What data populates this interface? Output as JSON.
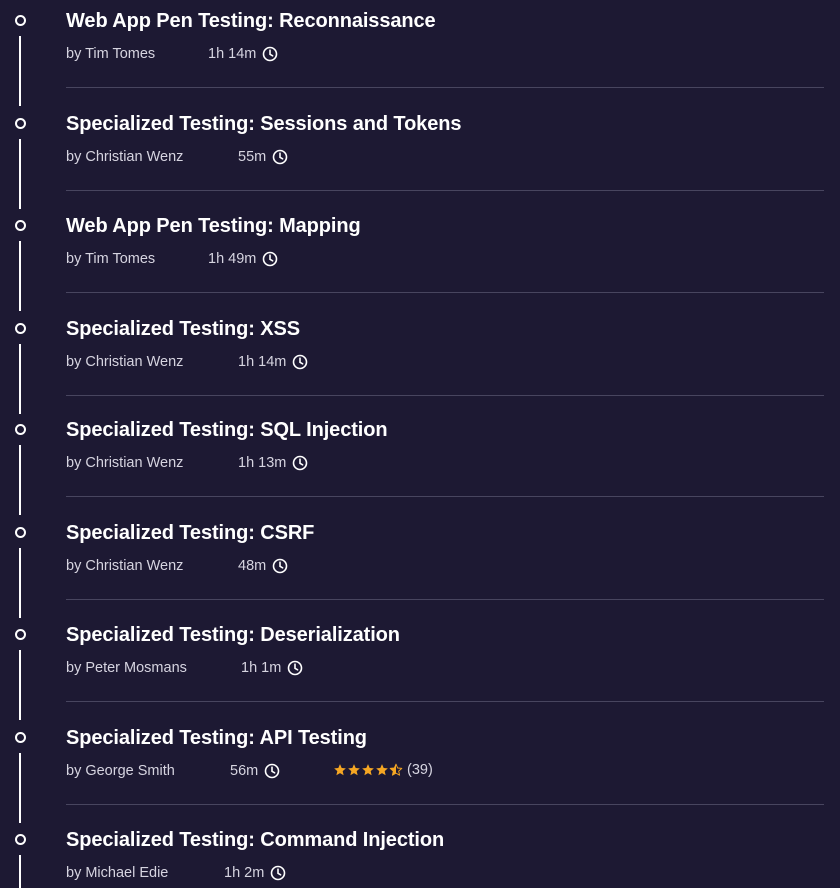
{
  "courses": [
    {
      "title": "Web App Pen Testing: Reconnaissance",
      "author": "by Tim Tomes",
      "duration": "1h 14m"
    },
    {
      "title": "Specialized Testing: Sessions and Tokens",
      "author": "by Christian Wenz",
      "duration": "55m"
    },
    {
      "title": "Web App Pen Testing: Mapping",
      "author": "by Tim Tomes",
      "duration": "1h 49m"
    },
    {
      "title": "Specialized Testing: XSS",
      "author": "by Christian Wenz",
      "duration": "1h 14m"
    },
    {
      "title": "Specialized Testing: SQL Injection",
      "author": "by Christian Wenz",
      "duration": "1h 13m"
    },
    {
      "title": "Specialized Testing: CSRF",
      "author": "by Christian Wenz",
      "duration": "48m"
    },
    {
      "title": "Specialized Testing: Deserialization",
      "author": "by Peter Mosmans",
      "duration": "1h 1m"
    },
    {
      "title": "Specialized Testing: API Testing",
      "author": "by George Smith",
      "duration": "56m",
      "rating": 4.5,
      "rating_count": "(39)"
    },
    {
      "title": "Specialized Testing: Command Injection",
      "author": "by Michael Edie",
      "duration": "1h 2m"
    }
  ],
  "colors": {
    "background": "#1d1933",
    "star": "#f5a623",
    "divider": "#48455f"
  },
  "icons": {
    "clock": "clock-icon",
    "star": "star-icon",
    "timeline_node": "timeline-node-icon"
  }
}
